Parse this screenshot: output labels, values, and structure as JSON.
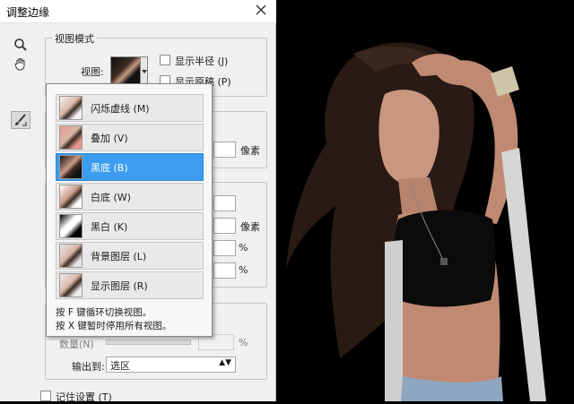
{
  "window": {
    "title": "调整边缘"
  },
  "view_mode": {
    "group_title": "视图模式",
    "view_label": "视图:",
    "show_radius": "显示半径 (J)",
    "show_original": "显示原稿 (P)"
  },
  "popup": {
    "items": [
      {
        "label": "闪烁虚线 (M)",
        "selected": false
      },
      {
        "label": "叠加 (V)",
        "selected": false
      },
      {
        "label": "黑底 (B)",
        "selected": true
      },
      {
        "label": "白底 (W)",
        "selected": false
      },
      {
        "label": "黑白 (K)",
        "selected": false
      },
      {
        "label": "背景图层 (L)",
        "selected": false
      },
      {
        "label": "显示图层 (R)",
        "selected": false
      }
    ],
    "hint_line1": "按 F 键循环切换视图。",
    "hint_line2": "按 X 键暂时停用所有视图。"
  },
  "fields": {
    "unit_pixels_1": "像素",
    "unit_pixels_2": "像素",
    "unit_percent_1": "%",
    "unit_percent_2": "%",
    "unit_percent_3": "%",
    "amount_label": "数量(N)"
  },
  "output": {
    "label": "输出到:",
    "selected": "选区"
  },
  "remember": {
    "label": "记住设置 (T)"
  },
  "colors": {
    "selection": "#3b9cf0",
    "dialog_bg": "#f0f0f0"
  },
  "icons": [
    "close-icon",
    "zoom-icon",
    "hand-icon",
    "refine-brush-icon",
    "chevron-down-icon"
  ]
}
